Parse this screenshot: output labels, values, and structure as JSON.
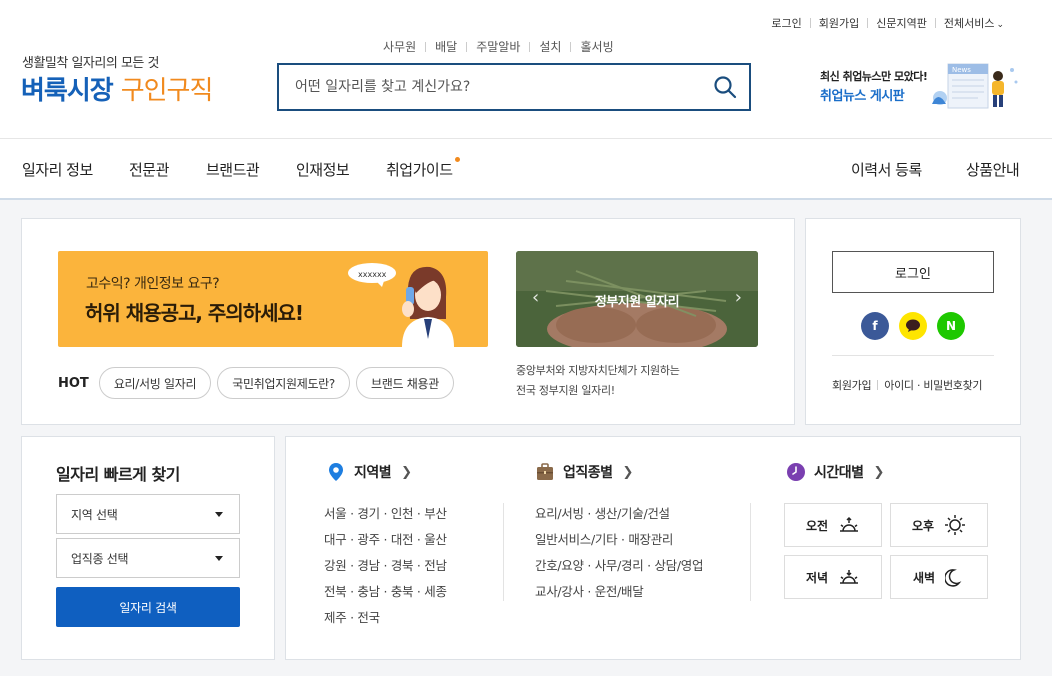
{
  "header": {
    "util_links": [
      "로그인",
      "회원가입",
      "신문지역판",
      "전체서비스"
    ],
    "logo_tagline": "생활밀착 일자리의 모든 것",
    "logo_name_a": "벼룩시장",
    "logo_name_b": "구인구직",
    "top_links": [
      "사무원",
      "배달",
      "주말알바",
      "설치",
      "홀서빙"
    ],
    "search_placeholder": "어떤 일자리를 찾고 계신가요?",
    "news_line1": "최신 취업뉴스만 모았다!",
    "news_line2": "취업뉴스 게시판",
    "news_icon_text": "News"
  },
  "nav": {
    "left": [
      "일자리 정보",
      "전문관",
      "브랜드관",
      "인재정보",
      "취업가이드"
    ],
    "right": [
      "이력서 등록",
      "상품안내"
    ]
  },
  "promo": {
    "line1": "고수익? 개인정보 요구?",
    "line2": "허위 채용공고, 주의하세요!",
    "bubble": "xxxxxx",
    "hot_label": "HOT",
    "chips": [
      "요리/서빙 일자리",
      "국민취업지원제도란?",
      "브랜드 채용관"
    ]
  },
  "gov": {
    "title": "정부지원 일자리",
    "desc1": "중앙부처와 지방자치단체가 지원하는",
    "desc2": "전국 정부지원 일자리!"
  },
  "login": {
    "button": "로그인",
    "social": [
      "f",
      "N"
    ],
    "links": [
      "회원가입",
      "아이디 · 비밀번호찾기"
    ]
  },
  "quick_search": {
    "title": "일자리 빠르게 찾기",
    "region_select": "지역 선택",
    "job_select": "업직종 선택",
    "button": "일자리 검색"
  },
  "categories": {
    "region": {
      "title": "지역별",
      "lines": [
        "서울 · 경기 · 인천 · 부산",
        "대구 · 광주 · 대전 · 울산",
        "강원 · 경남 · 경북 · 전남",
        "전북 · 충남 · 충북 · 세종",
        "제주 · 전국"
      ]
    },
    "job": {
      "title": "업직종별",
      "lines": [
        "요리/서빙 · 생산/기술/건설",
        "일반서비스/기타 · 매장관리",
        "간호/요양 · 사무/경리 · 상담/영업",
        "교사/강사 · 운전/배달"
      ]
    },
    "time": {
      "title": "시간대별",
      "slots": [
        "오전",
        "오후",
        "저녁",
        "새벽"
      ]
    }
  },
  "colors": {
    "brand_blue": "#1561b8",
    "brand_orange": "#f18a1e",
    "search_border": "#1a4d7e",
    "promo_yellow": "#fbb43c",
    "button_blue": "#0f5fc0"
  }
}
